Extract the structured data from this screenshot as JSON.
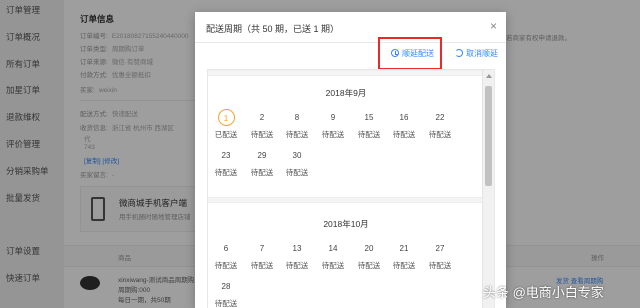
{
  "sidebar": {
    "items": [
      "订单管理",
      "订单概况",
      "所有订单",
      "加星订单",
      "退款维权",
      "评价管理",
      "分销采购单",
      "批量发货",
      "",
      "订单设置",
      "快速订单"
    ]
  },
  "order_info": {
    "title": "订单信息",
    "rows": [
      {
        "label": "订单编号:",
        "value": "E20180827155240440000"
      },
      {
        "label": "订单类型:",
        "value": "周期购订单"
      },
      {
        "label": "订单来源:",
        "value": "微信·有赞商城"
      },
      {
        "label": "付款方式:",
        "value": "优惠全额抵扣"
      },
      {
        "label": "买家:",
        "value": "weixin"
      },
      {
        "label": "配送方式:",
        "value": "快递配送"
      },
      {
        "label": "收货信息:",
        "value": "浙江省 杭州市 西湖区"
      },
      {
        "label": "",
        "value": "代"
      },
      {
        "label": "",
        "value": "743"
      },
      {
        "label": "",
        "value": "[复制] [修改]"
      },
      {
        "label": "买家留言:",
        "value": "-"
      }
    ],
    "right_note": "若商家有权申请退款。",
    "promo_title": "微商城手机客户端",
    "promo_sub": "用手机随时随地管理店铺",
    "table_col1": "商品",
    "table_col2": "操作",
    "goods_name": "xinxiwang-测试商品周期购",
    "goods_spec": "周期购:000",
    "goods_freq": "每日一期，共50期",
    "ops_text": "发货  查看周期购"
  },
  "modal": {
    "title": "配送周期（共 50 期，已送 1 期）",
    "close_icon": "close-icon",
    "defer_label": "顺延配送",
    "cancel_defer_label": "取消顺延",
    "highlight_color": "#e82a2a",
    "link_color": "#3388ff",
    "today_color": "#f5a623"
  },
  "calendar": {
    "months": [
      {
        "title": "2018年9月",
        "days": [
          {
            "num": "1",
            "status": "已配送",
            "today": true
          },
          {
            "num": "2",
            "status": "待配送"
          },
          {
            "num": "8",
            "status": "待配送"
          },
          {
            "num": "9",
            "status": "待配送"
          },
          {
            "num": "15",
            "status": "待配送"
          },
          {
            "num": "16",
            "status": "待配送"
          },
          {
            "num": "22",
            "status": "待配送"
          },
          {
            "num": "23",
            "status": "待配送"
          },
          {
            "num": "29",
            "status": "待配送"
          },
          {
            "num": "30",
            "status": "待配送"
          }
        ]
      },
      {
        "title": "2018年10月",
        "days": [
          {
            "num": "6",
            "status": "待配送"
          },
          {
            "num": "7",
            "status": "待配送"
          },
          {
            "num": "13",
            "status": "待配送"
          },
          {
            "num": "14",
            "status": "待配送"
          },
          {
            "num": "20",
            "status": "待配送"
          },
          {
            "num": "21",
            "status": "待配送"
          },
          {
            "num": "27",
            "status": "待配送"
          },
          {
            "num": "28",
            "status": "待配送"
          }
        ]
      }
    ]
  },
  "watermark": "头条 @电商小白专家"
}
